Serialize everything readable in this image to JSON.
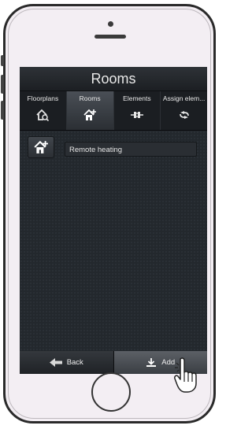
{
  "screen": {
    "title": "Rooms"
  },
  "tabs": [
    {
      "label": "Floorplans",
      "icon": "house-search-icon"
    },
    {
      "label": "Rooms",
      "icon": "house-add-icon"
    },
    {
      "label": "Elements",
      "icon": "connector-icon"
    },
    {
      "label": "Assign elem...",
      "icon": "transfer-icon"
    }
  ],
  "active_tab": "Rooms",
  "rooms": [
    {
      "name": "Remote heating",
      "icon": "house-add-icon"
    }
  ],
  "bottom_bar": {
    "back_label": "Back",
    "add_label": "Add"
  },
  "colors": {
    "screen_bg": "#1f2327",
    "text": "#e8e8e8"
  }
}
